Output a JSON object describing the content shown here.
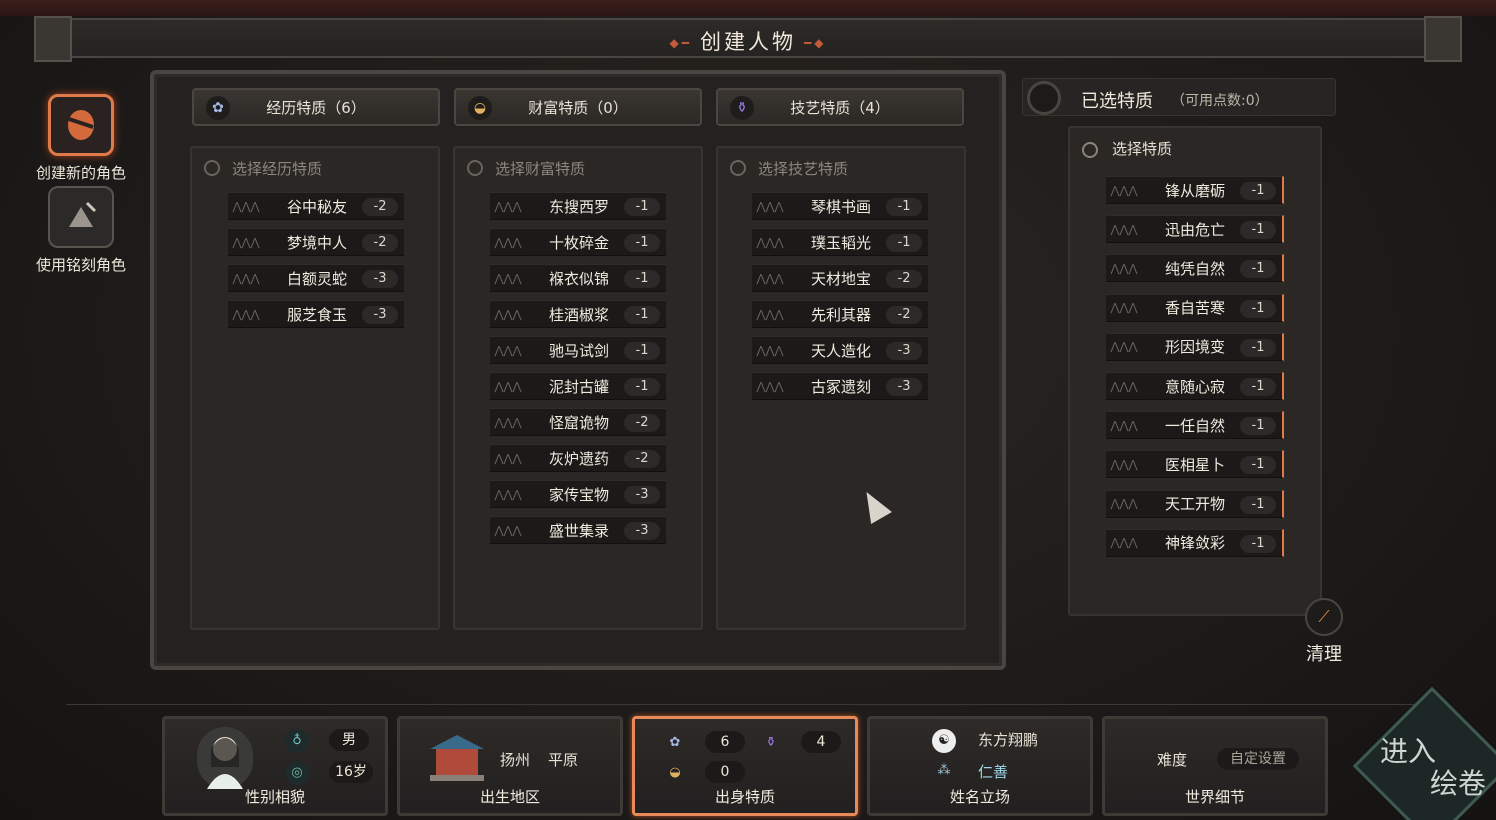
{
  "title": "创建人物",
  "sidebar": {
    "create_new": "创建新的角色",
    "use_engraved": "使用铭刻角色"
  },
  "categories": [
    {
      "label": "经历特质（6）",
      "head": "选择经历特质",
      "traits": [
        [
          "谷中秘友",
          "-2"
        ],
        [
          "梦境中人",
          "-2"
        ],
        [
          "白额灵蛇",
          "-3"
        ],
        [
          "服芝食玉",
          "-3"
        ]
      ]
    },
    {
      "label": "财富特质（0）",
      "head": "选择财富特质",
      "traits": [
        [
          "东搜西罗",
          "-1"
        ],
        [
          "十枚碎金",
          "-1"
        ],
        [
          "褓衣似锦",
          "-1"
        ],
        [
          "桂酒椒浆",
          "-1"
        ],
        [
          "驰马试剑",
          "-1"
        ],
        [
          "泥封古罐",
          "-1"
        ],
        [
          "怪窟诡物",
          "-2"
        ],
        [
          "灰炉遗药",
          "-2"
        ],
        [
          "家传宝物",
          "-3"
        ],
        [
          "盛世集录",
          "-3"
        ]
      ]
    },
    {
      "label": "技艺特质（4）",
      "head": "选择技艺特质",
      "traits": [
        [
          "琴棋书画",
          "-1"
        ],
        [
          "璞玉韬光",
          "-1"
        ],
        [
          "天材地宝",
          "-2"
        ],
        [
          "先利其器",
          "-2"
        ],
        [
          "天人造化",
          "-3"
        ],
        [
          "古冢遗刻",
          "-3"
        ]
      ]
    }
  ],
  "selected": {
    "title": "已选特质",
    "points": "（可用点数:0）",
    "head": "选择特质",
    "traits": [
      [
        "锋从磨砺",
        "-1"
      ],
      [
        "迅由危亡",
        "-1"
      ],
      [
        "纯凭自然",
        "-1"
      ],
      [
        "香自苦寒",
        "-1"
      ],
      [
        "形因境变",
        "-1"
      ],
      [
        "意随心寂",
        "-1"
      ],
      [
        "一任自然",
        "-1"
      ],
      [
        "医相星卜",
        "-1"
      ],
      [
        "天工开物",
        "-1"
      ],
      [
        "神锋敛彩",
        "-1"
      ]
    ]
  },
  "clear_label": "清理",
  "bottom": {
    "appearance": {
      "gender": "男",
      "age": "16岁",
      "label": "性别相貌"
    },
    "birthplace": {
      "city": "扬州",
      "terrain": "平原",
      "label": "出生地区"
    },
    "origin": {
      "exp": "6",
      "skill": "4",
      "wealth": "0",
      "label": "出身特质"
    },
    "name": {
      "name": "东方翔鹏",
      "stance": "仁善",
      "label": "姓名立场"
    },
    "world": {
      "diff_label": "难度",
      "diff_value": "自定设置",
      "label": "世界细节"
    }
  },
  "enter": {
    "line1": "进入",
    "line2": "绘卷"
  },
  "colors": {
    "accent": "#e07a4a",
    "panel": "#2a2725"
  }
}
